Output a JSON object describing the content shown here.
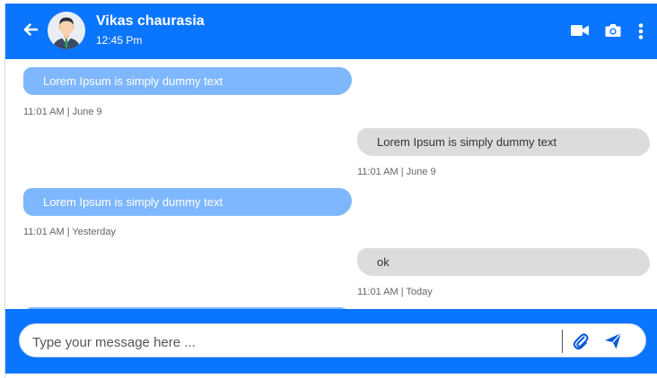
{
  "header": {
    "contact_name": "Vikas chaurasia",
    "contact_time": "12:45 Pm",
    "icons": [
      "back-arrow-icon",
      "video-camera-icon",
      "camera-icon",
      "more-vertical-icon"
    ]
  },
  "messages": [
    {
      "direction": "incoming",
      "text": "Lorem Ipsum is simply dummy text",
      "meta": "11:01 AM | June 9"
    },
    {
      "direction": "outgoing",
      "text": "Lorem Ipsum is simply dummy text",
      "meta": "11:01 AM | June 9"
    },
    {
      "direction": "incoming",
      "text": "Lorem Ipsum is simply dummy text",
      "meta": "11:01 AM | Yesterday"
    },
    {
      "direction": "outgoing",
      "text": "ok",
      "meta": "11:01 AM | Today"
    }
  ],
  "composer": {
    "placeholder": "Type your message here ...",
    "value": ""
  },
  "colors": {
    "primary": "#0a75ff",
    "incoming_bubble": "#7fb7ff",
    "outgoing_bubble": "#dcdcdc"
  }
}
